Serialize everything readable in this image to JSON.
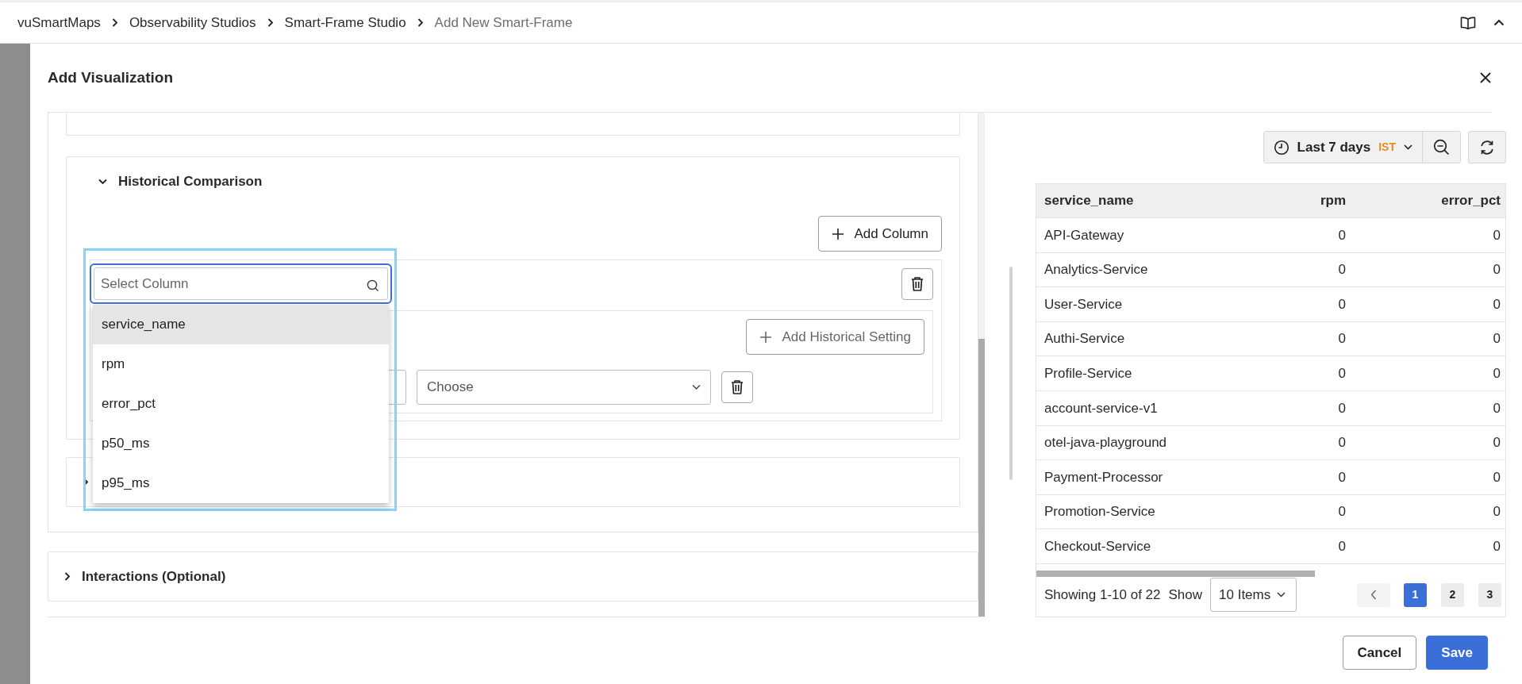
{
  "breadcrumb": [
    {
      "label": "vuSmartMaps",
      "current": false
    },
    {
      "label": "Observability Studios",
      "current": false
    },
    {
      "label": "Smart-Frame Studio",
      "current": false
    },
    {
      "label": "Add New Smart-Frame",
      "current": true
    }
  ],
  "modal": {
    "title": "Add Visualization"
  },
  "sections": [
    {
      "title": "Historical Comparison",
      "expanded": true,
      "add_column_button": "Add Column",
      "add_setting_button": "Add Historical Setting",
      "setting_select": {
        "placeholder": "Choose"
      },
      "column_picker": {
        "placeholder": "Select Column",
        "options": [
          {
            "label": "service_name",
            "selected": true
          },
          {
            "label": "rpm",
            "selected": false
          },
          {
            "label": "error_pct",
            "selected": false
          },
          {
            "label": "p50_ms",
            "selected": false
          },
          {
            "label": "p95_ms",
            "selected": false
          }
        ]
      }
    },
    {
      "expanded": false
    },
    {
      "title": "Interactions (Optional)",
      "expanded": false
    }
  ],
  "time_range": {
    "label": "Last 7 days",
    "timezone": "IST"
  },
  "table": {
    "columns": [
      "service_name",
      "rpm",
      "error_pct"
    ],
    "rows": [
      [
        "API-Gateway",
        "0",
        "0"
      ],
      [
        "Analytics-Service",
        "0",
        "0"
      ],
      [
        "User-Service",
        "0",
        "0"
      ],
      [
        "Authi-Service",
        "0",
        "0"
      ],
      [
        "Profile-Service",
        "0",
        "0"
      ],
      [
        "account-service-v1",
        "0",
        "0"
      ],
      [
        "otel-java-playground",
        "0",
        "0"
      ],
      [
        "Payment-Processor",
        "0",
        "0"
      ],
      [
        "Promotion-Service",
        "0",
        "0"
      ],
      [
        "Checkout-Service",
        "0",
        "0"
      ]
    ]
  },
  "pagination": {
    "summary": "Showing 1-10 of 22",
    "show_label": "Show",
    "page_size": "10 Items",
    "pages": [
      {
        "label": "1",
        "selected": true
      },
      {
        "label": "2",
        "selected": false
      },
      {
        "label": "3",
        "selected": false
      }
    ]
  },
  "footer_buttons": [
    {
      "label": "Cancel",
      "kind": "secondary"
    },
    {
      "label": "Save",
      "kind": "primary"
    }
  ]
}
